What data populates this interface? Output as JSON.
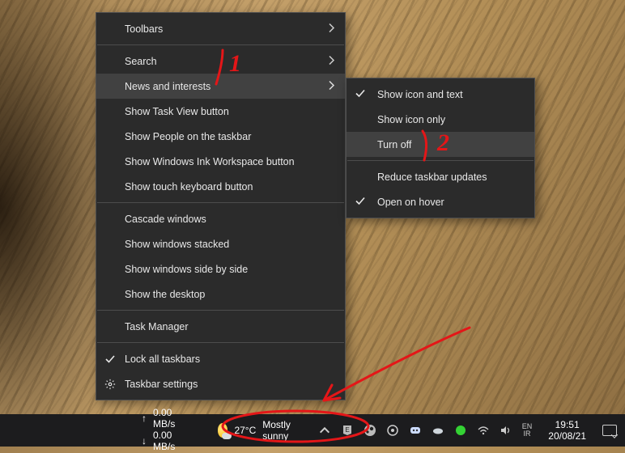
{
  "menu": {
    "items": [
      {
        "label": "Toolbars",
        "submenu": true
      },
      "sep",
      {
        "label": "Search",
        "submenu": true
      },
      {
        "label": "News and interests",
        "submenu": true,
        "hover": true
      },
      {
        "label": "Show Task View button"
      },
      {
        "label": "Show People on the taskbar"
      },
      {
        "label": "Show Windows Ink Workspace button"
      },
      {
        "label": "Show touch keyboard button"
      },
      "sep",
      {
        "label": "Cascade windows"
      },
      {
        "label": "Show windows stacked"
      },
      {
        "label": "Show windows side by side"
      },
      {
        "label": "Show the desktop"
      },
      "sep",
      {
        "label": "Task Manager"
      },
      "sep",
      {
        "label": "Lock all taskbars",
        "pre": "check"
      },
      {
        "label": "Taskbar settings",
        "pre": "gear"
      }
    ]
  },
  "submenu": {
    "items": [
      {
        "label": "Show icon and text",
        "checked": true
      },
      {
        "label": "Show icon only"
      },
      {
        "label": "Turn off",
        "hover": true
      },
      "sep",
      {
        "label": "Reduce taskbar updates"
      },
      {
        "label": "Open on hover",
        "checked": true
      }
    ]
  },
  "taskbar": {
    "net_up": "0.00 MB/s",
    "net_down": "0.00 MB/s",
    "weather_temp": "27°C",
    "weather_text": "Mostly sunny",
    "time": "19:51",
    "date": "20/08/21"
  },
  "annotations": {
    "label1": "1",
    "label2": "2"
  }
}
